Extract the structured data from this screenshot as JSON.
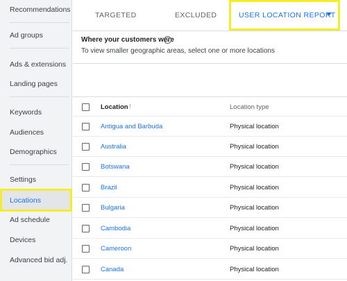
{
  "sidebar": {
    "items": [
      {
        "label": "Recommendations"
      },
      {
        "label": "Ad groups"
      },
      {
        "label": "Ads & extensions"
      },
      {
        "label": "Landing pages"
      },
      {
        "label": "Keywords"
      },
      {
        "label": "Audiences"
      },
      {
        "label": "Demographics"
      },
      {
        "label": "Settings"
      },
      {
        "label": "Locations"
      },
      {
        "label": "Ad schedule"
      },
      {
        "label": "Devices"
      },
      {
        "label": "Advanced bid adj."
      }
    ]
  },
  "tabs": [
    {
      "label": "TARGETED"
    },
    {
      "label": "EXCLUDED"
    },
    {
      "label": "USER LOCATION REPORT"
    }
  ],
  "report": {
    "title": "Where your customers were",
    "subtitle": "To view smaller geographic areas, select one or more locations"
  },
  "table": {
    "headers": {
      "location": "Location",
      "location_type": "Location type"
    },
    "rows": [
      {
        "location": "Antigua and Barbuda",
        "type": "Physical location"
      },
      {
        "location": "Australia",
        "type": "Physical location"
      },
      {
        "location": "Botswana",
        "type": "Physical location"
      },
      {
        "location": "Brazil",
        "type": "Physical location"
      },
      {
        "location": "Bulgaria",
        "type": "Physical location"
      },
      {
        "location": "Cambodia",
        "type": "Physical location"
      },
      {
        "location": "Cameroon",
        "type": "Physical location"
      },
      {
        "location": "Canada",
        "type": "Physical location"
      }
    ]
  },
  "colors": {
    "accent": "#1a73e8",
    "highlight": "#f4ee2a",
    "sidebar_bg": "#f1f3f4"
  },
  "icons": {
    "help": "help-circle-icon",
    "sort": "arrow-up-icon",
    "dropdown": "caret-down-icon"
  }
}
